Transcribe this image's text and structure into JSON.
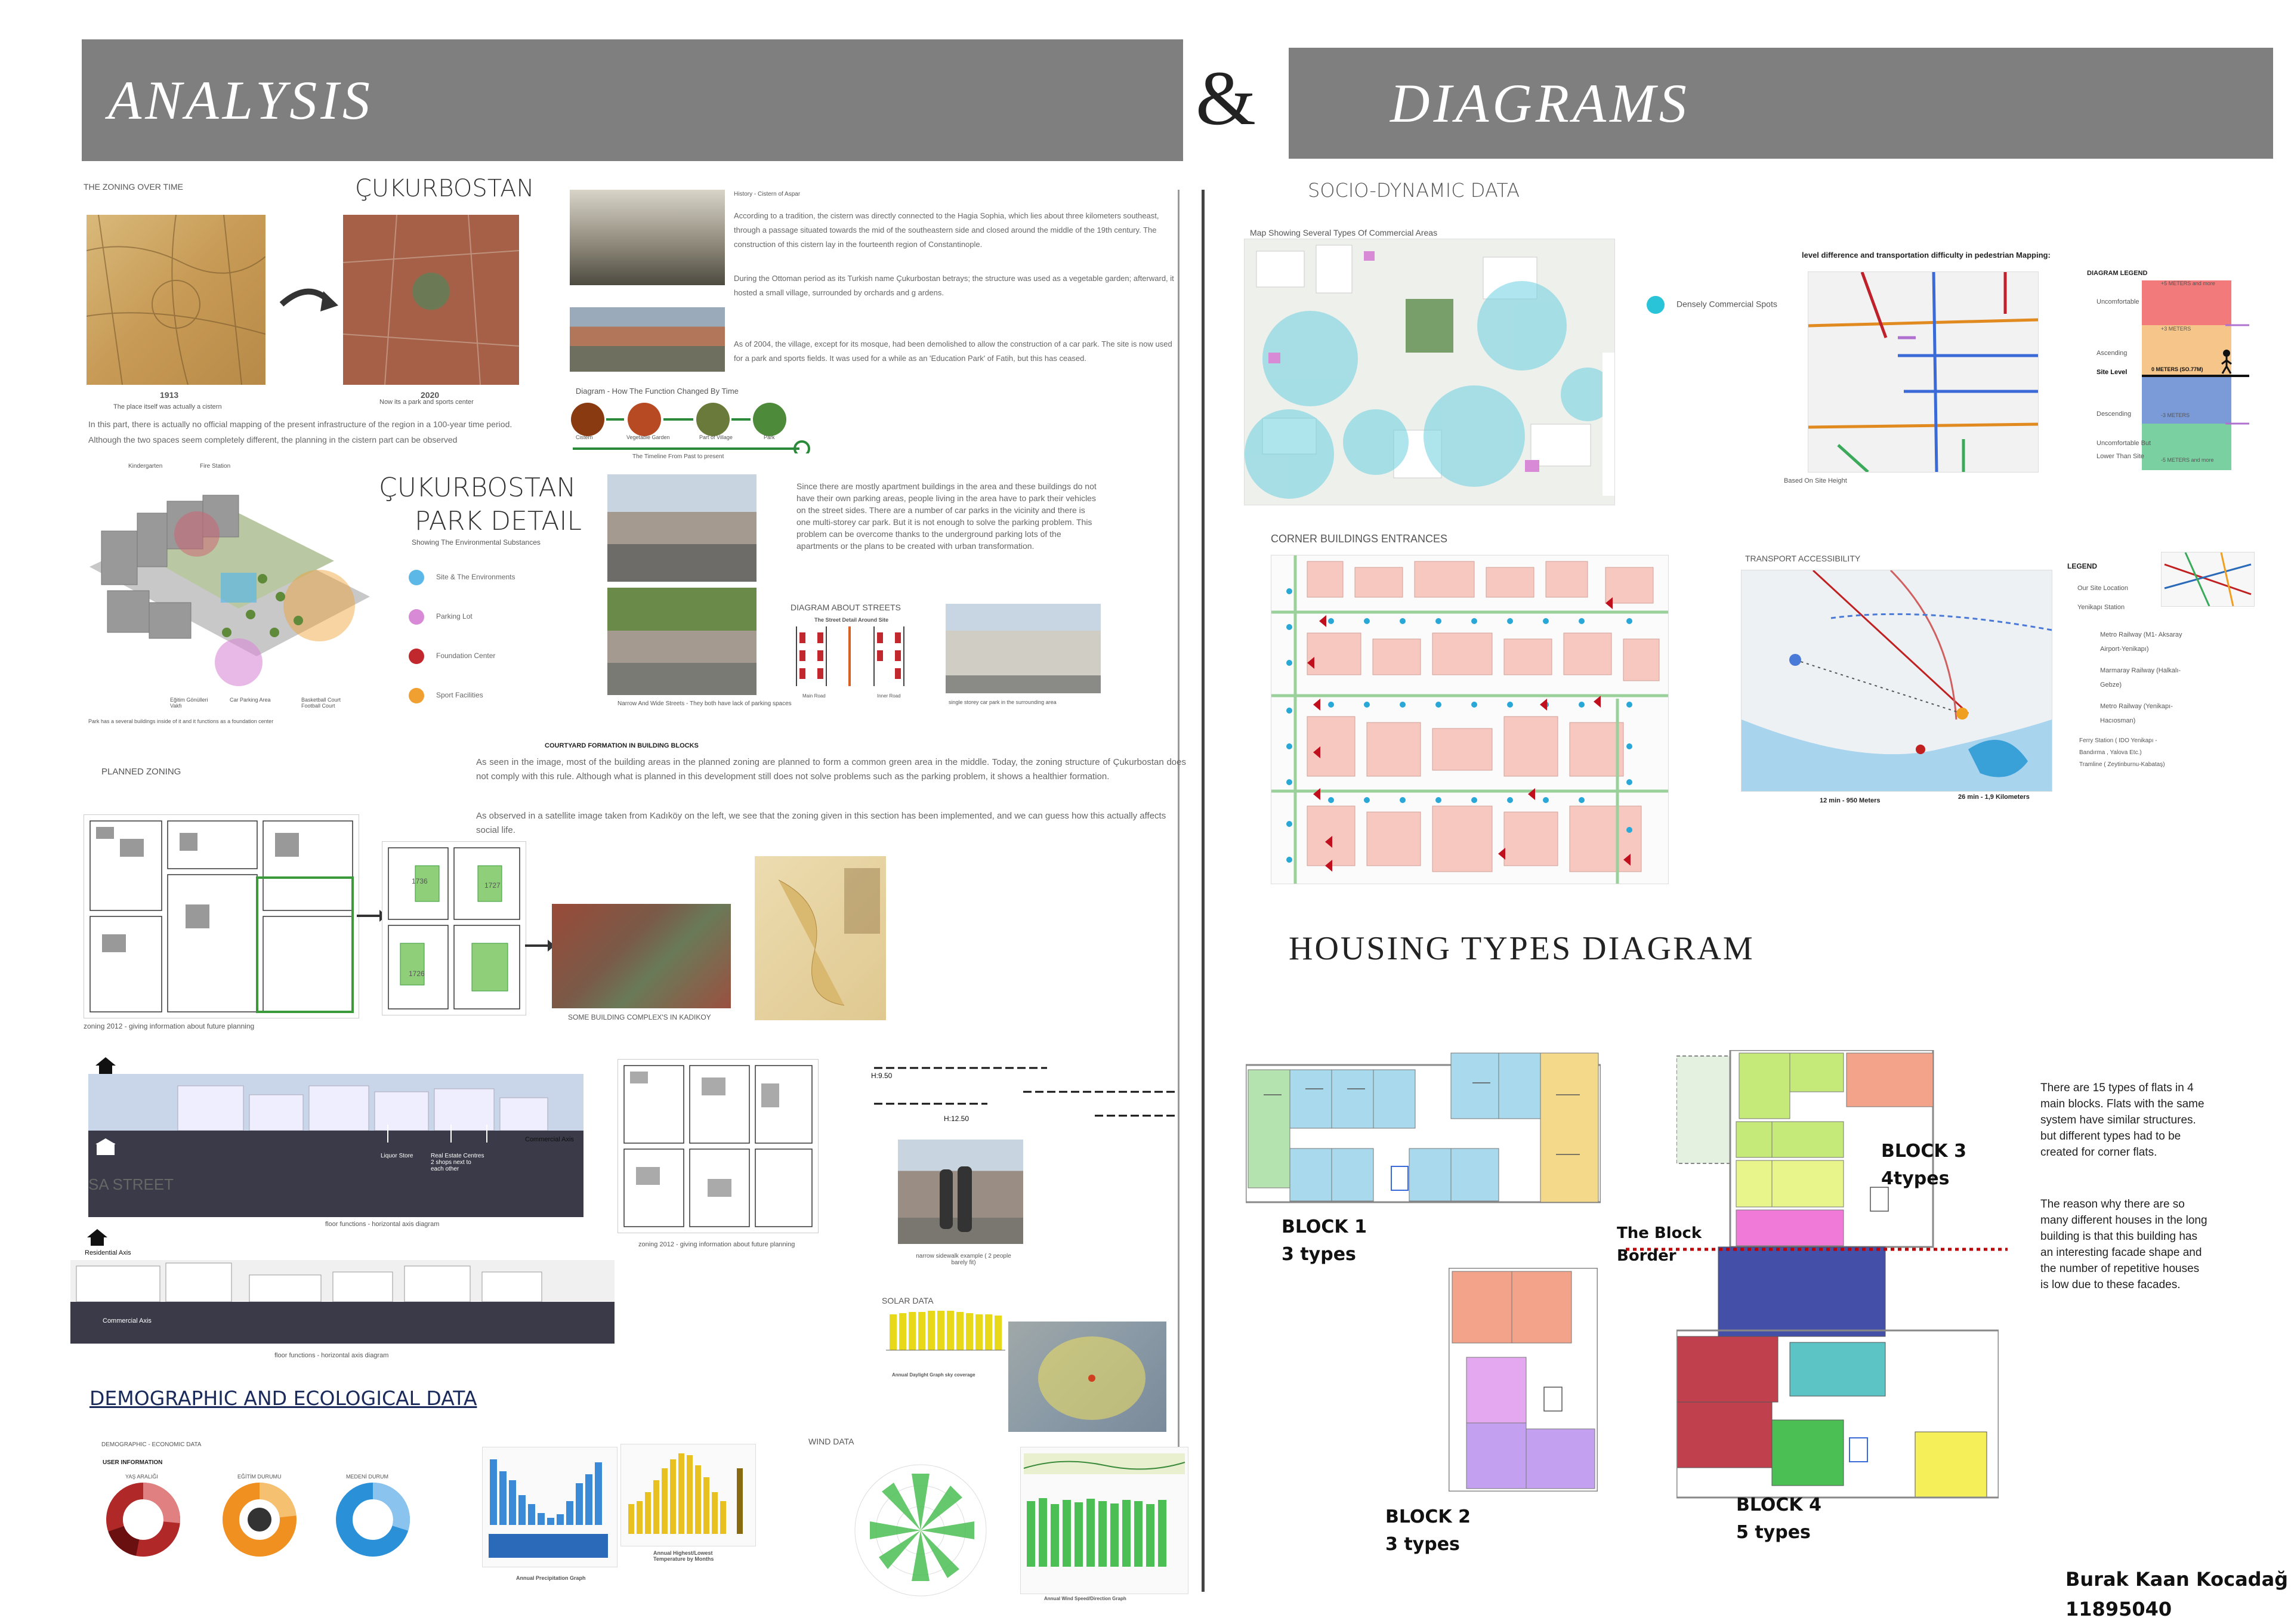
{
  "header": {
    "left_title": "ANALYSIS",
    "ampersand": "&",
    "right_title": "DIAGRAMS"
  },
  "zoning": {
    "label": "THE ZONING OVER TIME",
    "title": "ÇUKURBOSTAN",
    "year1": "1913",
    "caption1": "The place itself was actually a cistern",
    "year2": "2020",
    "caption2": "Now its a park and sports center",
    "text": "In this part, there is actually no official mapping of the present infrastructure of the region in a 100-year time period. Although the two spaces seem completely different, the planning in the cistern part can be observed"
  },
  "history": {
    "caption": "History - Cistern of Aspar",
    "para1": "According to a tradition, the cistern was directly connected to the Hagia Sophia, which lies about three kilometers southeast, through a passage situated towards the mid of the southeastern side and closed around the middle of the 19th century. The construction of this cistern lay in the fourteenth region of Constantinople.",
    "para2": "During the Ottoman period as its Turkish name Çukurbostan betrays; the structure was used as a vegetable garden; afterward, it hosted a small village, surrounded by orchards and g ardens.",
    "para3": "As of 2004, the village, except for its mosque, had been demolished to allow the construction of a car park. The site is now used for a park and sports fields. It was used for a while as an 'Education Park' of Fatih, but this has ceased.",
    "diagram_title": "Diagram - How The Function Changed By Time",
    "stages": [
      "Cistern",
      "Vegetable Garden",
      "Part of Village",
      "Park"
    ],
    "timeline": "The Timeline From Past to present"
  },
  "park": {
    "title1": "ÇUKURBOSTAN",
    "title2": "PARK DETAIL",
    "subtitle": "Showing The Environmental Substances",
    "legend": [
      {
        "label": "Site & The Environments",
        "color": "#5cb8e6"
      },
      {
        "label": "Parking Lot",
        "color": "#d88ad6"
      },
      {
        "label": "Foundation Center",
        "color": "#c0282d"
      },
      {
        "label": "Sport Facilities",
        "color": "#f0a030"
      }
    ],
    "iso_labels": [
      "Kindergarten",
      "Fire Station",
      "Eğitim Gönülleri Vakfı",
      "Car Parking Area",
      "Basketball Court Football Court"
    ],
    "iso_caption": "Park has a several buildings inside of it and it functions as a foundation center"
  },
  "streets": {
    "text": "Since there are mostly apartment buildings in the area and these buildings do not have their own parking areas, people living in the area have to park their vehicles on the street sides. There are a number of car parks in the vicinity and there is one multi-storey car park. But it is not enough to solve the parking problem. This problem can be overcome thanks to the underground parking lots of the apartments or the plans to be created with urban transformation.",
    "diagram_title": "DIAGRAM ABOUT STREETS",
    "diagram_sub": "The Street Detail Around Site",
    "road_labels": [
      "Main Road",
      "Inner Road"
    ],
    "photo_caption": "Narrow And Wide Streets - They both have lack of parking spaces",
    "carpark_caption": "single storey car park in the surrounding area"
  },
  "planned": {
    "label": "PLANNED ZONING",
    "heading": "COURTYARD FORMATION IN BUILDING BLOCKS",
    "para1": "As seen in the image, most of the building areas in the planned zoning are planned to form a common green area in the middle. Today, the zoning structure of Çukurbostan does not comply with this rule. Although what is planned in this development still does not solve problems such as the parking problem, it shows a healthier formation.",
    "para2": "As observed in a satellite image taken from Kadıköy on the left, we see that the zoning given in this section has been implemented, and we can guess how this actually affects social life.",
    "caption1": "zoning 2012 - giving information about future planning",
    "caption2": "SOME BUILDING COMPLEX'S IN KADIKOY",
    "plot_numbers": [
      "1726",
      "1727",
      "1736"
    ]
  },
  "axis": {
    "residential": "Residential Axis",
    "commercial": "Commercial Axis",
    "street": "SA STREET",
    "liquor": "Liquor Store",
    "real_estate": "Real Estate Centres 2 shops next to each other",
    "caption": "floor functions - horizontal axis diagram",
    "zoning_caption": "zoning 2012 - giving information about future planning",
    "narrow": "narrow sidewalk example ( 2 people barely fit)",
    "heights": [
      "H:9.50",
      "H:12.50"
    ]
  },
  "solar": {
    "label": "SOLAR DATA",
    "caption": "Annual Daylight Graph sky coverage"
  },
  "demographic": {
    "heading": "DEMOGRAPHIC AND ECOLOGICAL DATA",
    "sub": "DEMOGRAPHIC - ECONOMIC DATA",
    "user_info": "USER INFORMATION",
    "donut_titles": [
      "YAŞ ARALIĞI",
      "EĞİTİM DURUMU",
      "MEDENİ DURUM"
    ],
    "precip_caption": "Annual Precipitation Graph",
    "temp_caption": "Annual Highest/Lowest Temperature by Months",
    "wind_label": "WIND DATA",
    "wind_caption": "Annual Wind Speed/Direction Graph"
  },
  "socio": {
    "title": "SOCIO-DYNAMIC DATA",
    "map_caption": "Map Showing Several Types Of Commercial Areas",
    "dense_label": "Densely Commercial Spots",
    "level_title": "level difference and transportation difficulty in pedestrian Mapping:",
    "level_caption": "Based On Site Height",
    "legend_title": "DIAGRAM LEGEND",
    "level_items": [
      "+5 METERS and more",
      "+3 METERS",
      "0 METERS (SO.77M)",
      "-3 METERS",
      "-5 METERS and more"
    ],
    "level_labels": [
      "Uncomfortable",
      "Ascending",
      "Site Level",
      "Descending",
      "Uncomfortable But Lower Than Site"
    ],
    "corner_title": "CORNER BUILDINGS ENTRANCES",
    "transport_title": "TRANSPORT ACCESSIBILITY",
    "transport_legend": "LEGEND",
    "transport_items": [
      "Our Site Location",
      "Yenikapı Station",
      "Metro Railway (M1- Aksaray Airport-Yenikapı)",
      "Marmaray Railway (Halkalı-Gebze)",
      "Metro Railway (Yenikapı-Hacıosman)",
      "Ferry Station ( IDO Yenikapı - Bandırma , Yalova Etc.)",
      "Tramline ( Zeytinburnu-Kabataş)"
    ],
    "walk": "12 min - 950 Meters",
    "rail": "26 min - 1,9 Kilometers"
  },
  "housing": {
    "title": "HOUSING TYPES DIAGRAM",
    "block1": [
      "BLOCK 1",
      "3 types"
    ],
    "block2": [
      "BLOCK 2",
      "3 types"
    ],
    "block3": [
      "BLOCK 3",
      "4types"
    ],
    "block4": [
      "BLOCK 4",
      "5 types"
    ],
    "border": [
      "The Block",
      "Border"
    ],
    "desc1": "There are 15 types of flats in 4 main blocks. Flats with the same system have similar structures. but different types had to be created for corner flats.",
    "desc2": "The reason why there are so many different houses in the long building is that this building has an interesting facade shape and the number of repetitive houses is low due to these facades."
  },
  "author": {
    "name": "Burak Kaan Kocadağ",
    "id": "11895040"
  },
  "colors": {
    "banner": "#7f7f7f",
    "b1_green": "#b5e3b0",
    "b1_blue": "#a9d9ec",
    "b1_yellow": "#f4d98a",
    "salmon": "#f2a38a",
    "violet": "#cfa6f0",
    "lime": "#c6ea7a",
    "navy": "#4450a8",
    "crimson": "#c0404e",
    "teal": "#5cc4c4",
    "green": "#4cbf54",
    "yellow": "#f5f05a",
    "magenta": "#f07ad8",
    "border_red": "#c00000"
  }
}
